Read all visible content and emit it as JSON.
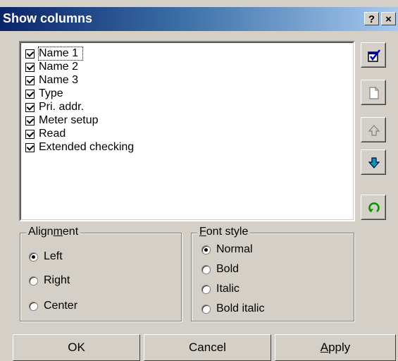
{
  "window": {
    "title": "Show columns",
    "help_label": "?",
    "close_label": "×"
  },
  "columns": {
    "items": [
      {
        "label": "Name 1",
        "checked": true
      },
      {
        "label": "Name 2",
        "checked": true
      },
      {
        "label": "Name 3",
        "checked": true
      },
      {
        "label": "Type",
        "checked": true
      },
      {
        "label": "Pri. addr.",
        "checked": true
      },
      {
        "label": "Meter setup",
        "checked": true
      },
      {
        "label": "Read",
        "checked": true
      },
      {
        "label": "Extended checking",
        "checked": true
      }
    ]
  },
  "side_buttons": [
    "select-all-icon",
    "new-page-icon",
    "move-up-icon",
    "move-down-icon",
    "reset-icon"
  ],
  "alignment": {
    "title_pre": "Align",
    "title_u": "m",
    "title_post": "ent",
    "options": [
      {
        "label": "Left",
        "selected": true
      },
      {
        "label": "Right",
        "selected": false
      },
      {
        "label": "Center",
        "selected": false
      }
    ]
  },
  "font_style": {
    "title_u": "F",
    "title_post": "ont style",
    "options": [
      {
        "label": "Normal",
        "selected": true
      },
      {
        "label": "Bold",
        "selected": false
      },
      {
        "label": "Italic",
        "selected": false
      },
      {
        "label": "Bold italic",
        "selected": false
      }
    ]
  },
  "buttons": {
    "ok": "OK",
    "cancel": "Cancel",
    "apply_u": "A",
    "apply_post": "pply"
  },
  "colors": {
    "title_bar": "#0a246a",
    "face": "#d4d0c8",
    "move_down": "#008080",
    "reset": "#009900"
  }
}
